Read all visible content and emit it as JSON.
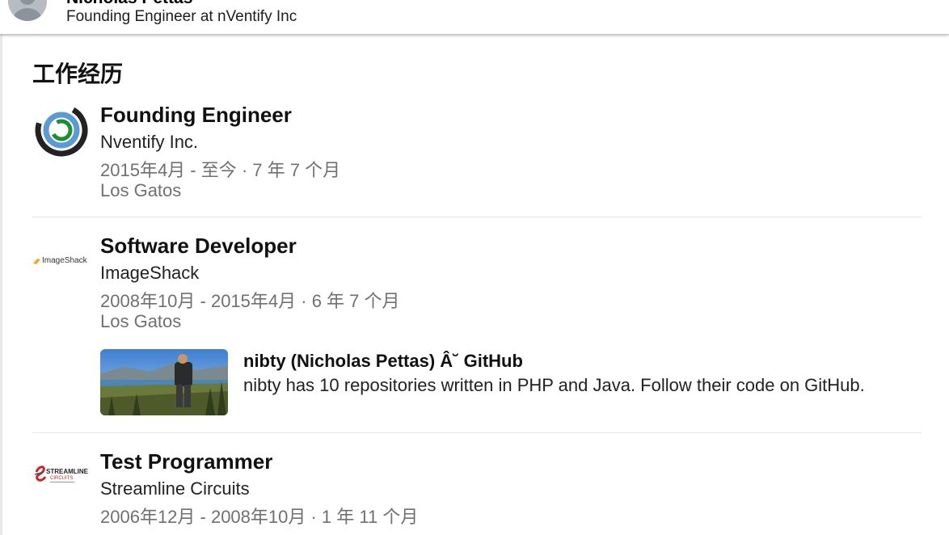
{
  "profile": {
    "name": "Nicholas Pettas",
    "headline": "Founding Engineer at nVentify Inc"
  },
  "section": {
    "title": "工作经历"
  },
  "experience": [
    {
      "title": "Founding Engineer",
      "company": "Nventify Inc.",
      "dates": "2015年4月 - 至今 · 7 年 7 个月",
      "location": "Los Gatos",
      "logo_icon": "nventify-logo-icon"
    },
    {
      "title": "Software Developer",
      "company": "ImageShack",
      "dates": "2008年10月 - 2015年4月 · 6 年 7 个月",
      "location": "Los Gatos",
      "logo_icon": "imageshack-logo-icon",
      "logo_text": "ImageShack",
      "media": {
        "title": "nibty (Nicholas Pettas) Â˘ GitHub",
        "description": "nibty has 10 repositories written in PHP and Java. Follow their code on GitHub."
      }
    },
    {
      "title": "Test Programmer",
      "company": "Streamline Circuits",
      "dates": "2006年12月 - 2008年10月 · 1 年 11 个月",
      "logo_icon": "streamline-circuits-logo-icon",
      "logo_text": "STREAMLINE",
      "logo_subtext": "CIRCUITS"
    }
  ],
  "colors": {
    "nventify_green": "#1c8f2e",
    "nventify_blue": "#5b9bd5",
    "imageshack_orange": "#f5a623",
    "streamline_red": "#c62828",
    "muted_text": "#707070"
  }
}
